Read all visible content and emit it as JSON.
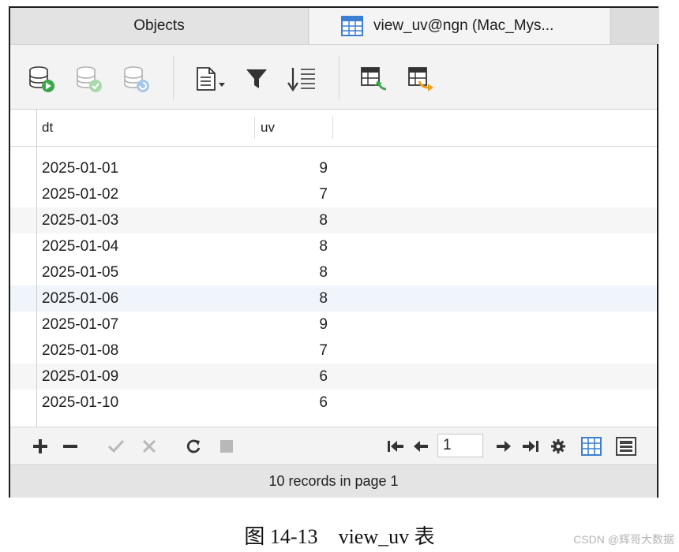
{
  "tabs": {
    "objects_label": "Objects",
    "view_label": "view_uv@ngn (Mac_Mys..."
  },
  "toolbar": {
    "icons": [
      "db-run-icon",
      "db-commit-icon",
      "db-refresh-icon",
      "document-menu-icon",
      "filter-icon",
      "sort-icon",
      "import-table-icon",
      "export-table-icon"
    ]
  },
  "grid": {
    "columns": [
      "dt",
      "uv"
    ],
    "rows": [
      {
        "dt": "2025-01-01",
        "uv": "9"
      },
      {
        "dt": "2025-01-02",
        "uv": "7"
      },
      {
        "dt": "2025-01-03",
        "uv": "8"
      },
      {
        "dt": "2025-01-04",
        "uv": "8"
      },
      {
        "dt": "2025-01-05",
        "uv": "8"
      },
      {
        "dt": "2025-01-06",
        "uv": "8"
      },
      {
        "dt": "2025-01-07",
        "uv": "9"
      },
      {
        "dt": "2025-01-08",
        "uv": "7"
      },
      {
        "dt": "2025-01-09",
        "uv": "6"
      },
      {
        "dt": "2025-01-10",
        "uv": "6"
      }
    ]
  },
  "bottombar": {
    "page_value": "1"
  },
  "status": {
    "text": "10 records in page 1"
  },
  "caption": {
    "figure": "图 14-13",
    "name": "view_uv 表"
  },
  "watermark": "CSDN @辉哥大数据",
  "colors": {
    "accent_blue": "#3d7fd1",
    "green": "#3aa84a",
    "orange": "#f0a020"
  }
}
